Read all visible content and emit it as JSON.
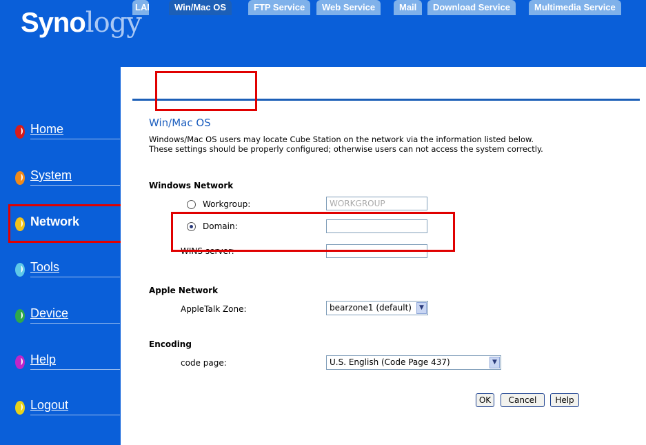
{
  "brand": {
    "bold": "Syno",
    "light": "logy",
    "mark": "®"
  },
  "sidebar": {
    "items": [
      {
        "label": "Home",
        "icon": "home-icon",
        "color": "#d81b1b"
      },
      {
        "label": "System",
        "icon": "system-icon",
        "color": "#f08a1a"
      },
      {
        "label": "Network",
        "icon": "network-icon",
        "color": "#f2c21a",
        "active": true
      },
      {
        "label": "Tools",
        "icon": "tools-icon",
        "color": "#5ec8e8"
      },
      {
        "label": "Device",
        "icon": "device-icon",
        "color": "#2ea84a"
      },
      {
        "label": "Help",
        "icon": "help-icon",
        "color": "#c026c8"
      },
      {
        "label": "Logout",
        "icon": "logout-icon",
        "color": "#e6d21a"
      }
    ]
  },
  "tabs": [
    {
      "label": "LAN"
    },
    {
      "label": "Win/Mac OS",
      "active": true
    },
    {
      "label": "FTP Service"
    },
    {
      "label": "Web Service"
    },
    {
      "label": "Mail"
    },
    {
      "label": "Download Service"
    },
    {
      "label": "Multimedia Service"
    }
  ],
  "page": {
    "title": "Win/Mac OS",
    "description_line1": "Windows/Mac OS users may locate Cube Station on the network via the information listed below.",
    "description_line2": "These settings should be properly configured; otherwise users can not access the system correctly."
  },
  "windows_network": {
    "heading": "Windows Network",
    "workgroup_label": "Workgroup:",
    "workgroup_value": "WORKGROUP",
    "domain_label": "Domain:",
    "domain_value": "",
    "wins_label": "WINS server:",
    "wins_value": "",
    "selected": "domain"
  },
  "apple_network": {
    "heading": "Apple Network",
    "zone_label": "AppleTalk Zone:",
    "zone_value": "bearzone1 (default)"
  },
  "encoding": {
    "heading": "Encoding",
    "codepage_label": "code page:",
    "codepage_value": "U.S. English (Code Page 437)"
  },
  "buttons": {
    "ok": "OK",
    "cancel": "Cancel",
    "help": "Help"
  },
  "colors": {
    "background": "#0a5fd9",
    "tab_active": "#1c5fb7",
    "tab": "#7fb1ea",
    "highlight": "#e00000"
  }
}
